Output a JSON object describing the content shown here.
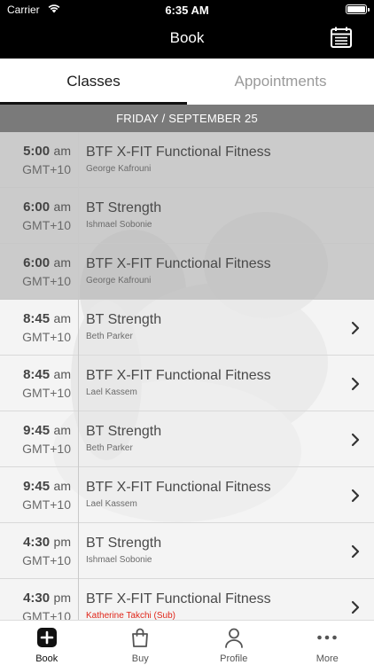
{
  "status_bar": {
    "carrier": "Carrier",
    "time": "6:35 AM"
  },
  "header": {
    "title": "Book",
    "calendar_icon": "calendar-icon"
  },
  "tabs": [
    {
      "label": "Classes",
      "active": true
    },
    {
      "label": "Appointments",
      "active": false
    }
  ],
  "date_header": "FRIDAY / SEPTEMBER 25",
  "classes": [
    {
      "time": "5:00",
      "ampm": "am",
      "tz": "GMT+10",
      "name": "BTF X-FIT Functional Fitness",
      "coach": "George Kafrouni",
      "past": true
    },
    {
      "time": "6:00",
      "ampm": "am",
      "tz": "GMT+10",
      "name": "BT Strength",
      "coach": "Ishmael Sobonie",
      "past": true
    },
    {
      "time": "6:00",
      "ampm": "am",
      "tz": "GMT+10",
      "name": "BTF X-FIT Functional Fitness",
      "coach": "George Kafrouni",
      "past": true
    },
    {
      "time": "8:45",
      "ampm": "am",
      "tz": "GMT+10",
      "name": "BT Strength",
      "coach": "Beth Parker",
      "past": false
    },
    {
      "time": "8:45",
      "ampm": "am",
      "tz": "GMT+10",
      "name": "BTF X-FIT Functional Fitness",
      "coach": "Lael Kassem",
      "past": false
    },
    {
      "time": "9:45",
      "ampm": "am",
      "tz": "GMT+10",
      "name": "BT Strength",
      "coach": "Beth Parker",
      "past": false
    },
    {
      "time": "9:45",
      "ampm": "am",
      "tz": "GMT+10",
      "name": "BTF X-FIT Functional Fitness",
      "coach": "Lael Kassem",
      "past": false
    },
    {
      "time": "4:30",
      "ampm": "pm",
      "tz": "GMT+10",
      "name": "BT Strength",
      "coach": "Ishmael Sobonie",
      "past": false
    },
    {
      "time": "4:30",
      "ampm": "pm",
      "tz": "GMT+10",
      "name": "BTF X-FIT Functional Fitness",
      "coach": "Katherine Takchi (Sub)",
      "past": false,
      "substitute": true
    }
  ],
  "tab_bar": [
    {
      "label": "Book",
      "icon": "plus-square-icon",
      "active": true
    },
    {
      "label": "Buy",
      "icon": "shopping-bag-icon",
      "active": false
    },
    {
      "label": "Profile",
      "icon": "person-icon",
      "active": false
    },
    {
      "label": "More",
      "icon": "ellipsis-icon",
      "active": false
    }
  ],
  "colors": {
    "header_bg": "#000000",
    "date_bar": "#7a7a7a",
    "substitute": "#e0261a"
  }
}
